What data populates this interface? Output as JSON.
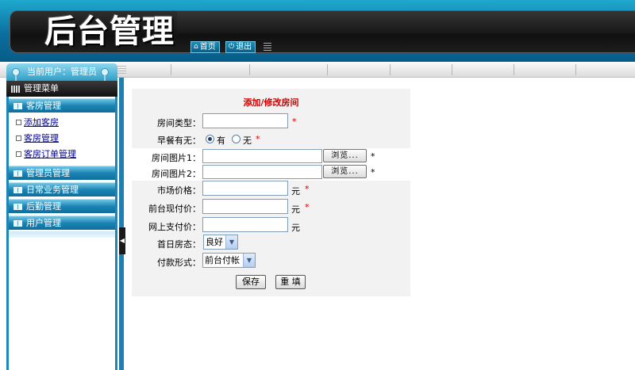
{
  "header": {
    "title": "后台管理",
    "home_label": "首页",
    "exit_label": "退出"
  },
  "sidebar": {
    "current_user": "当前用户：管理员",
    "menu_title": "管理菜单",
    "categories": [
      {
        "label": "客房管理",
        "items": [
          "添加客房",
          "客房管理",
          "客房订单管理"
        ]
      },
      {
        "label": "管理员管理"
      },
      {
        "label": "日常业务管理"
      },
      {
        "label": "后勤管理"
      },
      {
        "label": "用户管理"
      }
    ]
  },
  "form": {
    "title": "添加/修改房间",
    "room_type_label": "房间类型：",
    "breakfast_label": "早餐有无：",
    "breakfast_yes": "有",
    "breakfast_no": "无",
    "image1_label": "房间图片1：",
    "image2_label": "房间图片2：",
    "browse_label": "浏览...",
    "market_price_label": "市场价格：",
    "front_price_label": "前台现付价：",
    "online_price_label": "网上支付价：",
    "first_day_label": "首日房态：",
    "first_day_value": "良好",
    "payment_label": "付款形式：",
    "payment_value": "前台付帐",
    "unit": "元",
    "required_mark": "*",
    "save_label": "保存",
    "reset_label": "重 填"
  },
  "colors": {
    "accent": "#1c86b6",
    "required": "#cc0000",
    "link": "#00008b"
  }
}
